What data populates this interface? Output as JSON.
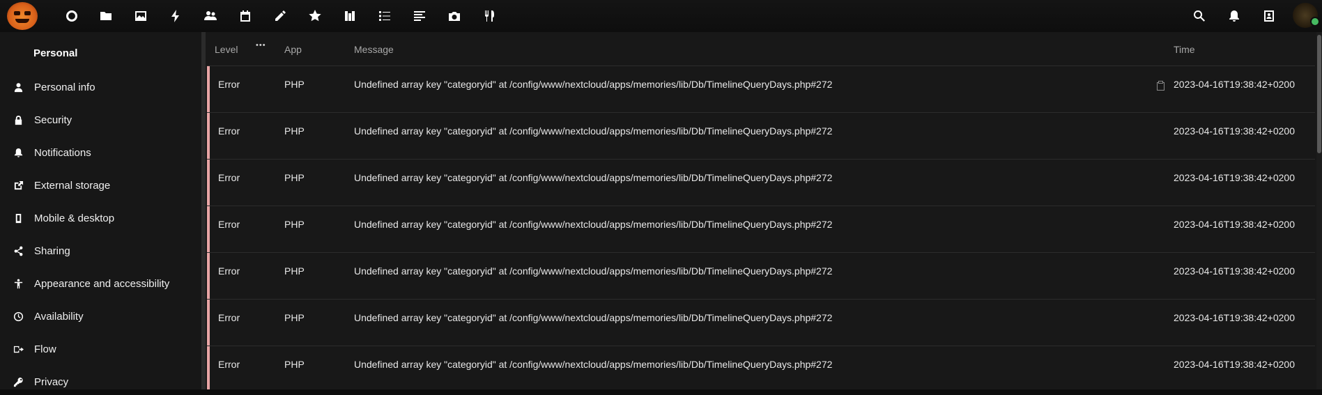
{
  "topnav": {
    "apps": [
      {
        "name": "dashboard-icon"
      },
      {
        "name": "files-icon"
      },
      {
        "name": "photos-icon"
      },
      {
        "name": "activity-icon"
      },
      {
        "name": "contacts-icon"
      },
      {
        "name": "calendar-icon"
      },
      {
        "name": "notes-icon"
      },
      {
        "name": "bookmarks-icon"
      },
      {
        "name": "deck-icon"
      },
      {
        "name": "tasks-icon"
      },
      {
        "name": "news-icon"
      },
      {
        "name": "memories-icon"
      },
      {
        "name": "cookbook-icon"
      }
    ],
    "right": [
      {
        "name": "search-icon"
      },
      {
        "name": "notifications-bell-icon"
      },
      {
        "name": "contacts-menu-icon"
      }
    ]
  },
  "sidebar": {
    "heading": "Personal",
    "items": [
      {
        "label": "Personal info",
        "icon": "user-icon"
      },
      {
        "label": "Security",
        "icon": "lock-icon"
      },
      {
        "label": "Notifications",
        "icon": "bell-icon"
      },
      {
        "label": "External storage",
        "icon": "external-link-icon"
      },
      {
        "label": "Mobile & desktop",
        "icon": "phone-icon"
      },
      {
        "label": "Sharing",
        "icon": "share-icon"
      },
      {
        "label": "Appearance and accessibility",
        "icon": "accessibility-icon"
      },
      {
        "label": "Availability",
        "icon": "clock-icon"
      },
      {
        "label": "Flow",
        "icon": "flow-icon"
      },
      {
        "label": "Privacy",
        "icon": "key-icon"
      }
    ]
  },
  "table": {
    "headers": {
      "level": "Level",
      "more": "•••",
      "app": "App",
      "message": "Message",
      "time": "Time"
    },
    "rows": [
      {
        "level": "Error",
        "app": "PHP",
        "message": "Undefined array key \"categoryid\" at /config/www/nextcloud/apps/memories/lib/Db/TimelineQueryDays.php#272",
        "time": "2023-04-16T19:38:42+0200"
      },
      {
        "level": "Error",
        "app": "PHP",
        "message": "Undefined array key \"categoryid\" at /config/www/nextcloud/apps/memories/lib/Db/TimelineQueryDays.php#272",
        "time": "2023-04-16T19:38:42+0200"
      },
      {
        "level": "Error",
        "app": "PHP",
        "message": "Undefined array key \"categoryid\" at /config/www/nextcloud/apps/memories/lib/Db/TimelineQueryDays.php#272",
        "time": "2023-04-16T19:38:42+0200"
      },
      {
        "level": "Error",
        "app": "PHP",
        "message": "Undefined array key \"categoryid\" at /config/www/nextcloud/apps/memories/lib/Db/TimelineQueryDays.php#272",
        "time": "2023-04-16T19:38:42+0200"
      },
      {
        "level": "Error",
        "app": "PHP",
        "message": "Undefined array key \"categoryid\" at /config/www/nextcloud/apps/memories/lib/Db/TimelineQueryDays.php#272",
        "time": "2023-04-16T19:38:42+0200"
      },
      {
        "level": "Error",
        "app": "PHP",
        "message": "Undefined array key \"categoryid\" at /config/www/nextcloud/apps/memories/lib/Db/TimelineQueryDays.php#272",
        "time": "2023-04-16T19:38:42+0200"
      },
      {
        "level": "Error",
        "app": "PHP",
        "message": "Undefined array key \"categoryid\" at /config/www/nextcloud/apps/memories/lib/Db/TimelineQueryDays.php#272",
        "time": "2023-04-16T19:38:42+0200"
      }
    ]
  },
  "colors": {
    "error_accent": "#e8a5a5",
    "background": "#181818",
    "sidebar": "#171717",
    "status_online": "#46ba61"
  }
}
